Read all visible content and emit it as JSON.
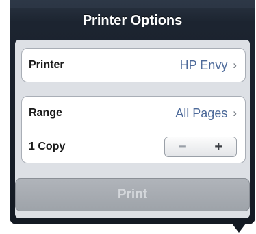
{
  "popover": {
    "title": "Printer Options"
  },
  "printer_row": {
    "label": "Printer",
    "value": "HP Envy"
  },
  "range_row": {
    "label": "Range",
    "value": "All Pages"
  },
  "copies_row": {
    "label": "1 Copy",
    "decrement_symbol": "−",
    "increment_symbol": "+"
  },
  "print_button": {
    "label": "Print"
  },
  "icons": {
    "chevron": "chevron-right-icon"
  }
}
